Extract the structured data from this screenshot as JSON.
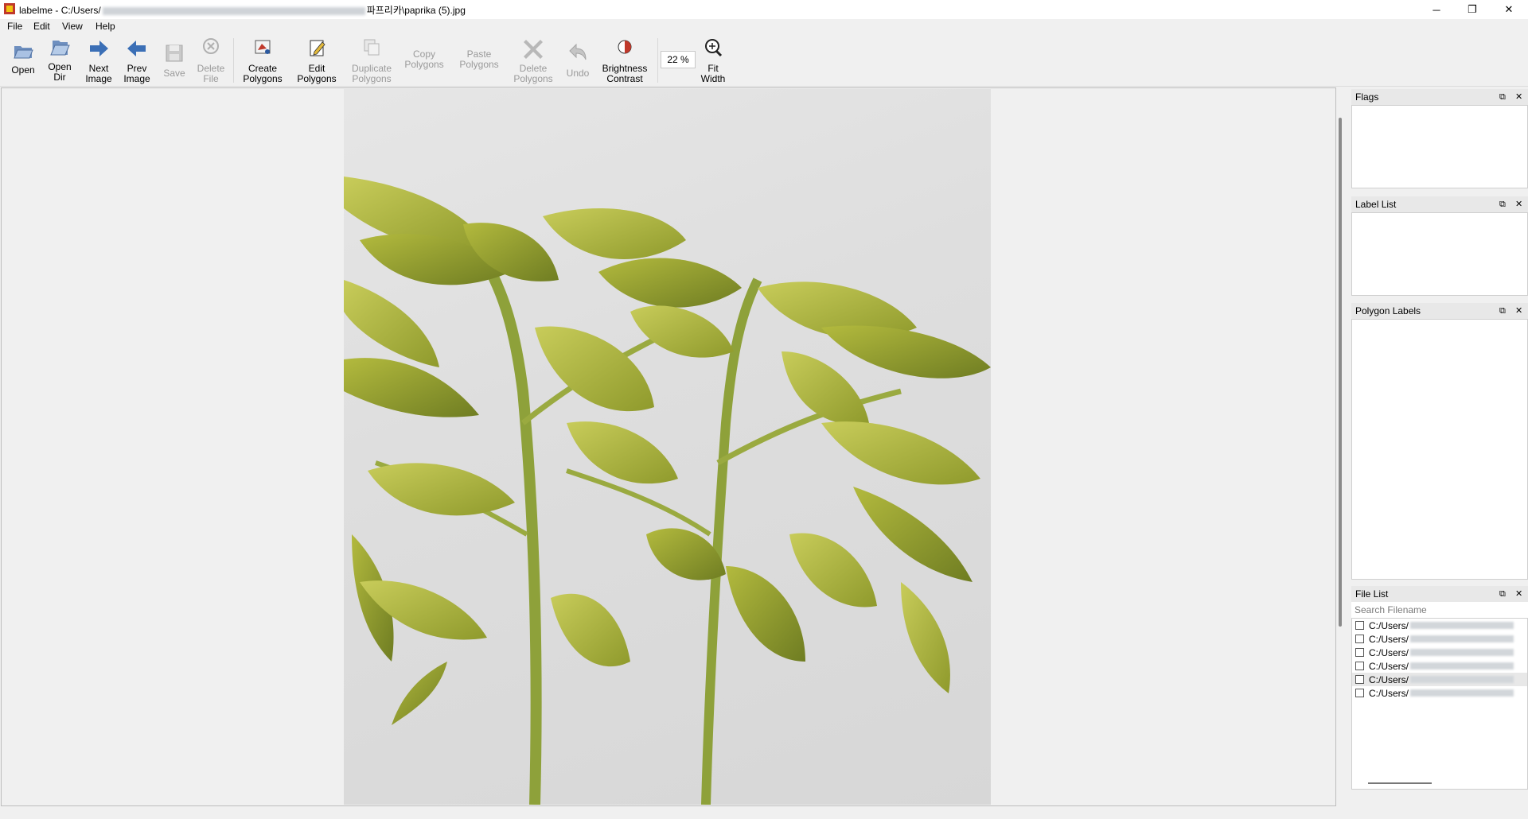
{
  "window": {
    "title_prefix": "labelme - C:/Users/",
    "title_suffix": "파프리카\\paprika (5).jpg",
    "minimize": "─",
    "restore": "❐",
    "close": "✕"
  },
  "menu": [
    "File",
    "Edit",
    "View",
    "Help"
  ],
  "toolbar": {
    "open": [
      "Open"
    ],
    "open_dir": [
      "Open",
      "Dir"
    ],
    "next_image": [
      "Next",
      "Image"
    ],
    "prev_image": [
      "Prev",
      "Image"
    ],
    "save": [
      "Save"
    ],
    "delete_file": [
      "Delete",
      "File"
    ],
    "create_polygons": [
      "Create",
      "Polygons"
    ],
    "edit_polygons": [
      "Edit",
      "Polygons"
    ],
    "duplicate_polygons": [
      "Duplicate",
      "Polygons"
    ],
    "copy_polygons": [
      "Copy",
      "Polygons"
    ],
    "paste_polygons": [
      "Paste",
      "Polygons"
    ],
    "delete_polygons": [
      "Delete",
      "Polygons"
    ],
    "undo": [
      "Undo"
    ],
    "brightness_contrast": [
      "Brightness",
      "Contrast"
    ],
    "zoom_value": "22 %",
    "fit_width": [
      "Fit",
      "Width"
    ]
  },
  "docks": {
    "flags": {
      "title": "Flags"
    },
    "label_list": {
      "title": "Label List"
    },
    "polygon_labels": {
      "title": "Polygon Labels"
    },
    "file_list": {
      "title": "File List",
      "search_placeholder": "Search Filename",
      "files": [
        "C:/Users/",
        "C:/Users/",
        "C:/Users/",
        "C:/Users/",
        "C:/Users/",
        "C:/Users/"
      ]
    }
  },
  "icons": {
    "app": "labelme-icon",
    "open": "folder-open-icon",
    "open_dir": "folder-icon",
    "next": "arrow-right-icon",
    "prev": "arrow-left-icon",
    "save": "floppy-icon",
    "delete_file": "circle-x-icon",
    "create": "polygon-create-icon",
    "edit": "edit-icon",
    "duplicate": "duplicate-icon",
    "delete_poly": "x-icon",
    "undo": "undo-icon",
    "brightness": "brightness-icon",
    "fit_width": "zoom-icon"
  },
  "colors": {
    "accent": "#3b6fb6",
    "leaf": "#a9b43a",
    "wall": "#dcdcdc"
  }
}
